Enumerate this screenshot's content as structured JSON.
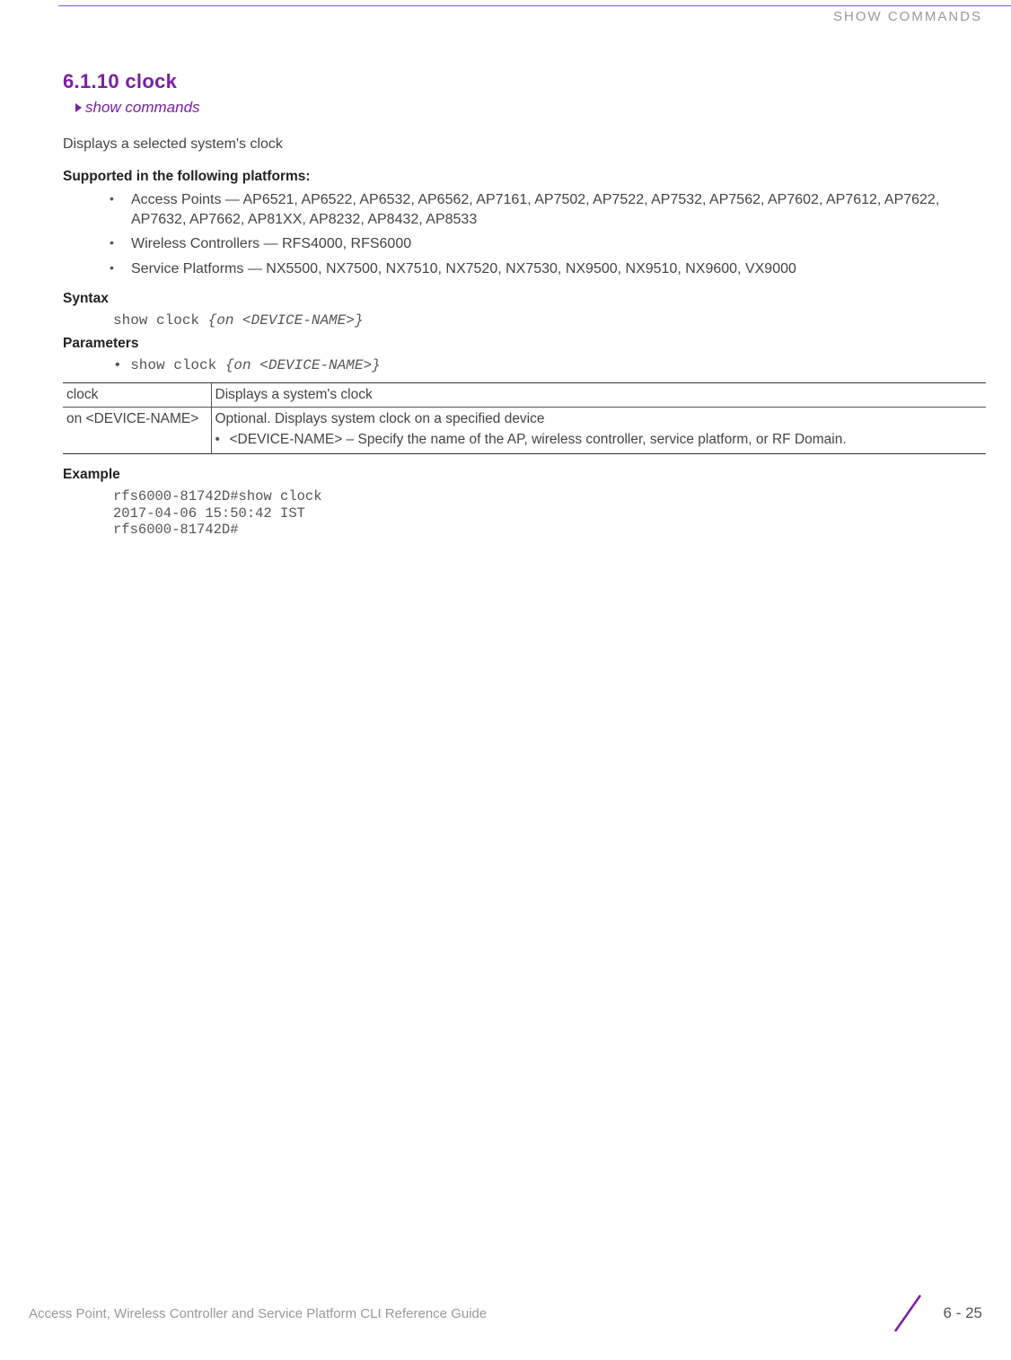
{
  "header": {
    "running": "SHOW COMMANDS"
  },
  "section": {
    "number_title": "6.1.10 clock",
    "breadcrumb": "show commands",
    "description": "Displays a selected system's clock"
  },
  "platforms": {
    "heading": "Supported in the following platforms:",
    "items": [
      "Access Points — AP6521, AP6522, AP6532, AP6562, AP7161, AP7502, AP7522, AP7532, AP7562, AP7602, AP7612, AP7622, AP7632, AP7662, AP81XX, AP8232, AP8432, AP8533",
      "Wireless Controllers — RFS4000, RFS6000",
      "Service Platforms — NX5500, NX7500, NX7510, NX7520, NX7530, NX9500, NX9510, NX9600, VX9000"
    ]
  },
  "syntax": {
    "heading": "Syntax",
    "cmd_plain": "show clock ",
    "cmd_italic": "{on <DEVICE-NAME>}"
  },
  "parameters": {
    "heading": "Parameters",
    "bullet_plain": "• show clock ",
    "bullet_italic": "{on <DEVICE-NAME>}",
    "table": [
      {
        "param": "clock",
        "desc": "Displays a system's clock",
        "sub": []
      },
      {
        "param": "on <DEVICE-NAME>",
        "desc": "Optional. Displays system clock on a specified device",
        "sub": [
          "<DEVICE-NAME> – Specify the name of the AP, wireless controller, service platform, or RF Domain."
        ]
      }
    ]
  },
  "example": {
    "heading": "Example",
    "lines": "rfs6000-81742D#show clock\n2017-04-06 15:50:42 IST\nrfs6000-81742D#"
  },
  "footer": {
    "title": "Access Point, Wireless Controller and Service Platform CLI Reference Guide",
    "page": "6 - 25"
  }
}
